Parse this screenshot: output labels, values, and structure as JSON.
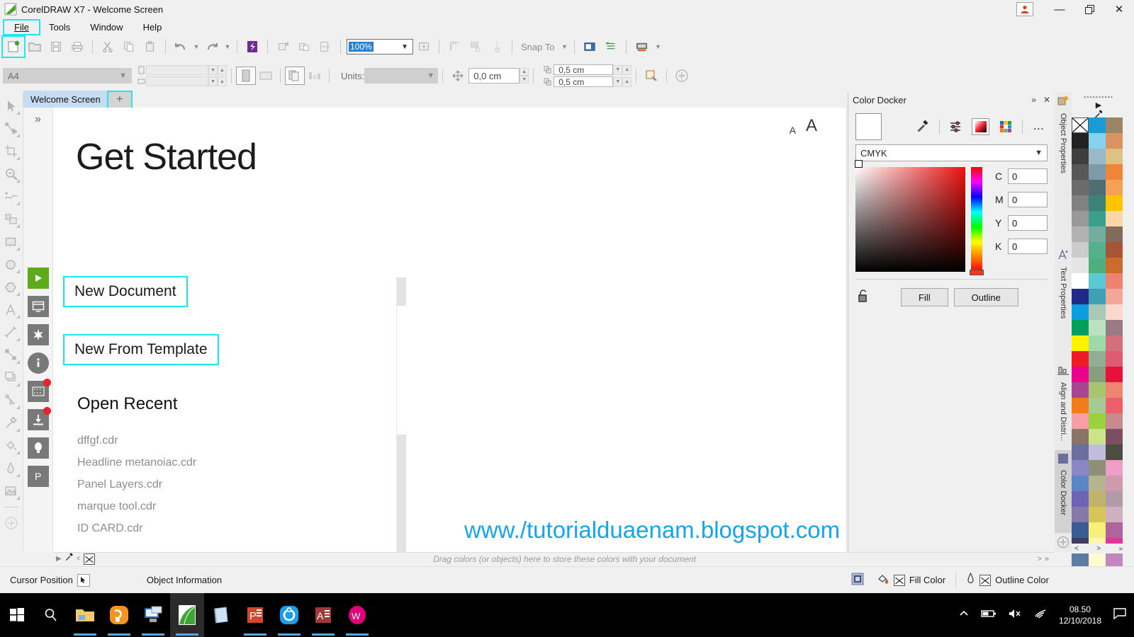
{
  "window": {
    "title": "CorelDRAW X7 - Welcome Screen",
    "logo_icon": "coreldraw-logo-icon",
    "user_icon": "user-account-icon",
    "minimize_icon": "minimize-icon",
    "restore_icon": "restore-icon",
    "close_icon": "close-icon"
  },
  "menu": {
    "items": [
      {
        "label": "File",
        "selected": true
      },
      {
        "label": "Tools",
        "selected": false
      },
      {
        "label": "Window",
        "selected": false
      },
      {
        "label": "Help",
        "selected": false
      }
    ]
  },
  "toolbar": {
    "new_icon": "new-document-icon",
    "open_icon": "open-folder-icon",
    "save_icon": "save-icon",
    "print_icon": "print-icon",
    "cut_icon": "cut-scissors-icon",
    "copy_icon": "copy-icon",
    "paste_icon": "paste-icon",
    "undo_icon": "undo-arrow-icon",
    "redo_icon": "redo-arrow-icon",
    "connect_icon": "corel-connect-icon",
    "import_icon": "import-icon",
    "export_icon": "export-icon",
    "publish_pdf_icon": "publish-to-pdf-icon",
    "zoom_value": "100%",
    "fullscreen_icon": "full-screen-preview-icon",
    "rulers_icon": "show-rulers-icon",
    "grid_icon": "show-grid-icon",
    "guides_icon": "show-guidelines-icon",
    "snap_to_label": "Snap To",
    "options_icon": "options-icon",
    "object_manager_icon": "object-manager-icon",
    "app_launcher_icon": "application-launcher-icon"
  },
  "properties_bar": {
    "page_size": "A4",
    "width_value": "",
    "height_value": "",
    "portrait_icon": "portrait-orientation-icon",
    "landscape_icon": "landscape-orientation-icon",
    "all_pages_icon": "all-pages-icon",
    "current_page_icon": "current-page-icon",
    "units_label": "Units:",
    "units_value": "",
    "nudge_value": "0,0 cm",
    "duplicate_x": "0,5 cm",
    "duplicate_y": "0,5 cm",
    "treat_as_filled_icon": "treat-as-filled-icon",
    "add_icon": "add-toolbar-item-icon"
  },
  "tabs": {
    "document_tab": "Welcome Screen",
    "new_tab_label": "+"
  },
  "toolbox": {
    "tools": [
      {
        "name": "pick-tool-icon"
      },
      {
        "name": "shape-tool-icon"
      },
      {
        "name": "crop-tool-icon"
      },
      {
        "name": "zoom-tool-icon"
      },
      {
        "name": "freehand-tool-icon"
      },
      {
        "name": "smart-fill-tool-icon"
      },
      {
        "name": "rectangle-tool-icon"
      },
      {
        "name": "ellipse-tool-icon"
      },
      {
        "name": "polygon-tool-icon"
      },
      {
        "name": "text-tool-icon"
      },
      {
        "name": "parallel-dimension-tool-icon"
      },
      {
        "name": "straight-line-connector-tool-icon"
      },
      {
        "name": "drop-shadow-tool-icon"
      },
      {
        "name": "transparency-tool-icon"
      },
      {
        "name": "color-eyedropper-tool-icon"
      },
      {
        "name": "interactive-fill-tool-icon"
      },
      {
        "name": "outline-pen-tool-icon"
      },
      {
        "name": "fill-tool-icon"
      },
      {
        "name": "quick-customize-icon"
      }
    ]
  },
  "welcome_rail": {
    "expand_icon": "chevron-double-right-icon",
    "buttons": [
      {
        "name": "get-started-icon",
        "style": "green"
      },
      {
        "name": "workspace-icon",
        "style": "grey"
      },
      {
        "name": "whats-new-icon",
        "style": "grey"
      },
      {
        "name": "learning-info-icon",
        "style": "grey"
      },
      {
        "name": "gallery-icon",
        "style": "grey",
        "badge": true
      },
      {
        "name": "get-more-download-icon",
        "style": "grey",
        "badge": true
      },
      {
        "name": "membership-icon",
        "style": "grey"
      },
      {
        "name": "product-details-icon",
        "style": "grey"
      }
    ]
  },
  "welcome": {
    "heading": "Get Started",
    "text_size_small": "A",
    "text_size_large": "A",
    "new_document": "New Document",
    "new_from_template": "New From Template",
    "open_recent_heading": "Open Recent",
    "recent_files": [
      "dffgf.cdr",
      "Headline metanoiac.cdr",
      "Panel Layers.cdr",
      "marque tool.cdr",
      "ID CARD.cdr"
    ],
    "watermark": "www./tutorialduaenam.blogspot.com",
    "watermark_color": "#15a5ec"
  },
  "color_docker": {
    "title": "Color Docker",
    "collapse_icon": "collapse-docker-icon",
    "close_icon": "close-docker-icon",
    "current_color": "#ffffff",
    "eyedropper_icon": "eyedropper-icon",
    "sliders_icon": "color-sliders-icon",
    "viewers_icon": "color-viewers-icon",
    "palettes_icon": "color-palettes-icon",
    "more_icon": "more-options-icon",
    "color_model": "CMYK",
    "lock_icon": "unlocked-padlock-icon",
    "channels": [
      {
        "label": "C",
        "value": "0"
      },
      {
        "label": "M",
        "value": "0"
      },
      {
        "label": "Y",
        "value": "0"
      },
      {
        "label": "K",
        "value": "0"
      }
    ],
    "fill_button": "Fill",
    "outline_button": "Outline"
  },
  "docker_tabs": [
    {
      "label": "Object Properties",
      "icon": "object-properties-icon",
      "active": false
    },
    {
      "label": "Text Properties",
      "icon": "text-properties-icon",
      "active": false
    },
    {
      "label": "Align and Distri...",
      "icon": "align-and-distribute-icon",
      "active": false
    },
    {
      "label": "Color Docker",
      "icon": "color-docker-icon",
      "active": true
    }
  ],
  "palette": {
    "no_color_icon": "no-color-x-icon",
    "eyedropper_icon": "palette-eyedropper-icon",
    "expand_icon": "palette-expand-arrow-icon",
    "prev_label": "<",
    "next_label": ">",
    "more_label": "»",
    "colors": [
      "#ffffff",
      "#1b9ad6",
      "#9c8466",
      "#222222",
      "#87d3ef",
      "#da9360",
      "#3e3e3e",
      "#9ab8c6",
      "#ddc283",
      "#575757",
      "#7c9aa8",
      "#f08438",
      "#6b6b6b",
      "#4f6e72",
      "#f4a158",
      "#818181",
      "#3d8279",
      "#ffc400",
      "#999999",
      "#3aa08a",
      "#fbd7a8",
      "#b2b2b2",
      "#74ada0",
      "#836b5c",
      "#cccccc",
      "#55b08e",
      "#a85535",
      "#e5e5e5",
      "#4fae7e",
      "#cb6b2c",
      "#ffffff",
      "#5cc8d4",
      "#f08070",
      "#222a87",
      "#3f9fb4",
      "#f2a79a",
      "#0d9ee0",
      "#a8c9b6",
      "#fbd8cd",
      "#00a05a",
      "#bbe0c2",
      "#9a7b85",
      "#fff200",
      "#9fd9a6",
      "#d4707d",
      "#ee1c25",
      "#93ad92",
      "#e05b72",
      "#ec008c",
      "#8a9d7c",
      "#e8113c",
      "#a94591",
      "#a9c471",
      "#ee8573",
      "#f07c1c",
      "#a7c993",
      "#ef5f6b",
      "#f6a0a6",
      "#9bd13e",
      "#c98a8f",
      "#8a7468",
      "#cde38a",
      "#7b4f62",
      "#6b6f9e",
      "#c0bcdd",
      "#4d4c42",
      "#8b86c4",
      "#8f8e76",
      "#ef9fc6",
      "#5a86c8",
      "#b8b291",
      "#cf9aab",
      "#6f63b4",
      "#c0b370",
      "#b29aa6",
      "#8479a8",
      "#d6c55b",
      "#cfb0bf",
      "#3a5d96",
      "#f7f07a",
      "#b0649e",
      "#433d5c",
      "#fbf8b4",
      "#e0359a",
      "#5c7da2",
      "#fdfbd2",
      "#c486c0"
    ]
  },
  "drag_strip": {
    "hint": "Drag colors (or objects) here to store these colors with your document",
    "expand_icon": "palette-arrow-icon",
    "eyedropper_icon": "strip-eyedropper-icon",
    "prev_icon": "<",
    "next_icon": ">",
    "more_icon": "»"
  },
  "status_bar": {
    "cursor_position_label": "Cursor Position",
    "cursor_icon": "cursor-arrow-icon",
    "object_information_label": "Object Information",
    "snapshot_icon": "snapshot-icon",
    "fill_bucket_icon": "fill-bucket-icon",
    "fill_swatch_icon": "no-fill-x-icon",
    "fill_color_label": "Fill Color",
    "outline_pen_icon": "outline-pen-icon",
    "outline_swatch_icon": "no-outline-x-icon",
    "outline_color_label": "Outline Color"
  },
  "taskbar": {
    "start_icon": "windows-start-icon",
    "search_icon": "search-icon",
    "apps": [
      {
        "name": "file-explorer-icon",
        "running": true,
        "active": false
      },
      {
        "name": "uc-browser-icon",
        "running": true,
        "active": false
      },
      {
        "name": "remote-desktop-icon",
        "running": true,
        "active": false
      },
      {
        "name": "coreldraw-icon",
        "running": true,
        "active": true
      },
      {
        "name": "notebook-app-icon",
        "running": false,
        "active": false
      },
      {
        "name": "powerpoint-icon",
        "running": true,
        "active": false
      },
      {
        "name": "sync-app-icon",
        "running": true,
        "active": false
      },
      {
        "name": "access-icon",
        "running": true,
        "active": false
      },
      {
        "name": "wordweb-icon",
        "running": true,
        "active": false
      }
    ],
    "tray": {
      "chevron_icon": "show-hidden-icons-icon",
      "battery_icon": "battery-icon",
      "volume_icon": "volume-muted-icon",
      "network_icon": "wifi-icon",
      "time": "08.50",
      "date": "12/10/2018",
      "action_center_icon": "action-center-icon"
    }
  },
  "theme": {
    "accent_cyan": "#1ee8ee",
    "tab_blue": "#c5dcf2",
    "chrome_grey": "#f0f0f0",
    "green": "#5bab1b"
  }
}
